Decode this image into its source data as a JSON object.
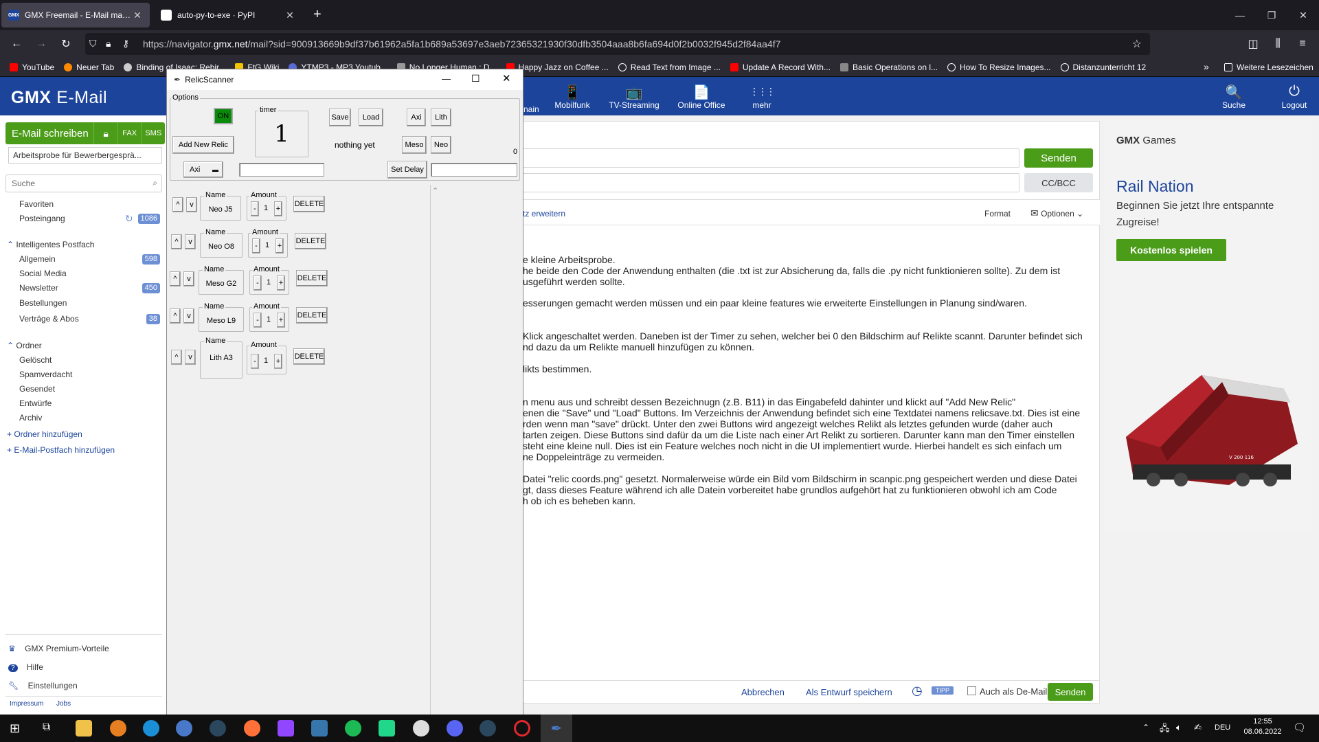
{
  "browser": {
    "tabs": [
      {
        "title": "GMX Freemail - E-Mail made in Germany",
        "active": true
      },
      {
        "title": "auto-py-to-exe · PyPI",
        "active": false
      }
    ],
    "url_prefix": "https://navigator.",
    "url_host": "gmx.net",
    "url_rest": "/mail?sid=900913669b9df37b61962a5fa1b689a53697e3aeb72365321930f30dfb3504aaa8b6fa694d0f2b0032f945d2f84aa4f7",
    "bookmarks": [
      "YouTube",
      "Neuer Tab",
      "Binding of Isaac: Rebir...",
      "FtG Wiki",
      "YTMP3 - MP3 Youtub...",
      "No Longer Human : D...",
      "Happy Jazz on Coffee ...",
      "Read Text from Image ...",
      "Update A Record With...",
      "Basic Operations on l...",
      "How To Resize Images...",
      "Distanzunterricht 12"
    ],
    "other_bookmarks": "Weitere Lesezeichen"
  },
  "gmx": {
    "logo": "GMX",
    "logo_sub": "E-Mail",
    "nav": [
      {
        "icon": "📱",
        "label": "Mobilfunk"
      },
      {
        "icon": "📺",
        "label": "TV-Streaming"
      },
      {
        "icon": "📄",
        "label": "Online Office"
      },
      {
        "icon": "⋮⋮⋮",
        "label": "mehr"
      }
    ],
    "nav_right": [
      {
        "icon": "🔍",
        "label": "Suche"
      },
      {
        "icon": "⏻",
        "label": "Logout"
      }
    ],
    "nav_partial": "nain"
  },
  "sidebar": {
    "write": "E-Mail schreiben",
    "fax": "FAX",
    "sms": "SMS",
    "draft": "Arbeitsprobe für Bewerbergesprä...",
    "search": "Suche",
    "items1": [
      {
        "label": "Favoriten",
        "badge": ""
      },
      {
        "label": "Posteingang",
        "badge": "1086"
      }
    ],
    "group1": "Intelligentes Postfach",
    "items2": [
      {
        "label": "Allgemein",
        "badge": "598"
      },
      {
        "label": "Social Media",
        "badge": ""
      },
      {
        "label": "Newsletter",
        "badge": "450"
      },
      {
        "label": "Bestellungen",
        "badge": ""
      },
      {
        "label": "Verträge & Abos",
        "badge": "38"
      }
    ],
    "group2": "Ordner",
    "items3": [
      "Gelöscht",
      "Spamverdacht",
      "Gesendet",
      "Entwürfe",
      "Archiv"
    ],
    "add_folder": "Ordner hinzufügen",
    "add_mailbox": "E-Mail-Postfach hinzufügen",
    "footer": [
      "GMX Premium-Vorteile",
      "Hilfe",
      "Einstellungen"
    ],
    "legal": [
      "Impressum",
      "Jobs"
    ]
  },
  "compose": {
    "send": "Senden",
    "ccbcc": "CC/BCC",
    "expand": "tz erweitern",
    "format": "Format",
    "options": "Optionen",
    "body": [
      "e kleine Arbeitsprobe.",
      "he beide den Code der Anwendung enthalten (die .txt ist zur Absicherung da, falls die .py nicht funktionieren sollte). Zu dem ist",
      "usgeführt werden sollte.",
      "esserungen gemacht werden müssen und ein paar kleine features wie erweiterte Einstellungen in Planung sind/waren.",
      "Klick angeschaltet werden. Daneben ist der Timer zu sehen, welcher bei 0 den Bildschirm auf Relikte scannt. Darunter befindet sich",
      "nd dazu da um Relikte manuell hinzufügen zu können.",
      "likts bestimmen.",
      "n menu aus und schreibt dessen Bezeichnugn (z.B. B11) in das Eingabefeld dahinter und klickt auf \"Add New Relic\"",
      "enen die \"Save\" und \"Load\" Buttons. Im Verzeichnis der Anwendung befindet sich eine Textdatei namens relicsave.txt. Dies ist eine",
      "rden wenn man \"save\" drückt. Unter den zwei Buttons wird angezeigt welches Relikt als letztes gefunden wurde (daher auch",
      "tarten zeigen. Diese Buttons sind dafür da um die Liste nach einer Art Relikt zu sortieren. Darunter kann man den Timer einstellen",
      " steht eine kleine null. Dies ist ein Feature welches noch nicht in die UI implementiert wurde. Hierbei handelt es sich einfach um",
      "ne Doppeleinträge zu vermeiden.",
      " Datei \"relic coords.png\" gesetzt. Normalerweise würde ein Bild vom Bildschirm in scanpic.png gespeichert werden und diese Datei",
      "gt, dass dieses Feature während ich alle Datein vorbereitet habe grundlos aufgehört hat zu funktionieren obwohl ich am Code",
      "h ob ich es beheben kann."
    ],
    "cancel": "Abbrechen",
    "save_draft": "Als Entwurf speichern",
    "tipp": "TIPP",
    "demail": "Auch als De-Mail",
    "send_bottom": "Senden"
  },
  "ad": {
    "brand": "GMX",
    "brand_sub": "Games",
    "title": "Rail Nation",
    "text": "Beginnen Sie jetzt Ihre entspannte Zugreise!",
    "cta": "Kostenlos spielen",
    "loco_number": "V 200 116"
  },
  "relic": {
    "title": "RelicScanner",
    "options_label": "Options",
    "on": "ON",
    "timer_label": "timer",
    "timer_value": "1",
    "save": "Save",
    "load": "Load",
    "axi": "Axi",
    "lith": "Lith",
    "meso": "Meso",
    "neo": "Neo",
    "add": "Add New Relic",
    "last_found": "nothing yet",
    "zero": "0",
    "dropdown": "Axi",
    "set_delay": "Set Delay",
    "name_label": "Name",
    "amount_label": "Amount",
    "delete": "DELETE",
    "up": "^",
    "down": "v",
    "minus": "-",
    "plus": "+",
    "rows": [
      {
        "name": "Neo J5",
        "amount": "1"
      },
      {
        "name": "Neo O8",
        "amount": "1"
      },
      {
        "name": "Meso G2",
        "amount": "1"
      },
      {
        "name": "Meso L9",
        "amount": "1"
      },
      {
        "name": "Lith A3",
        "amount": "1"
      }
    ]
  },
  "taskbar": {
    "lang": "DEU",
    "time": "12:55",
    "date": "08.06.2022"
  }
}
